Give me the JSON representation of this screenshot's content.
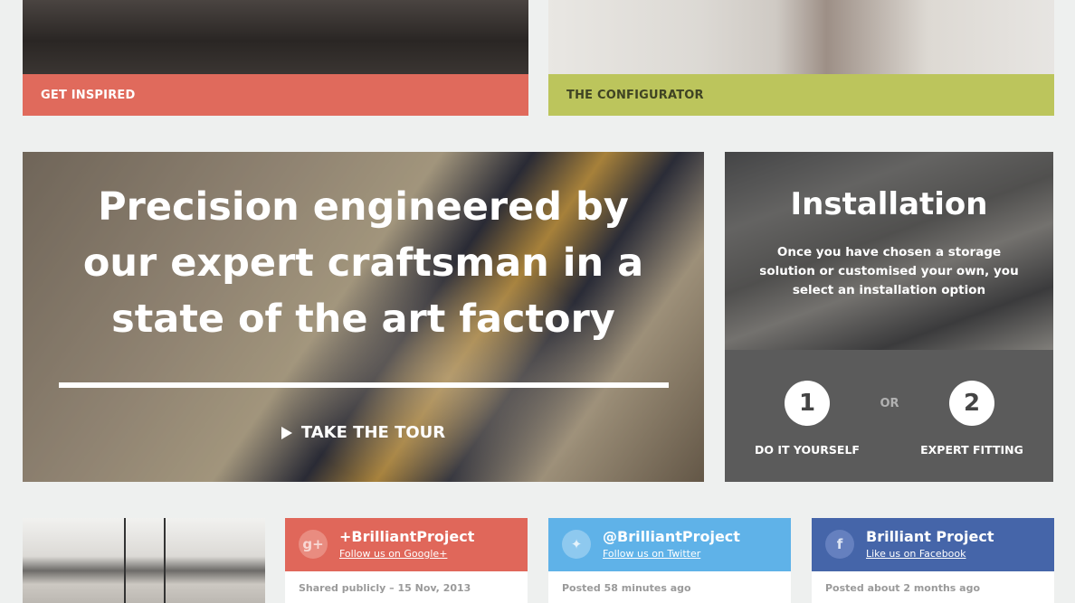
{
  "top_tiles": {
    "inspired_label": "GET INSPIRED",
    "configurator_label": "THE CONFIGURATOR"
  },
  "hero": {
    "headline": "Precision engineered by our expert craftsman in a state of the art factory",
    "cta_label": "TAKE THE TOUR"
  },
  "installation": {
    "title": "Installation",
    "description": "Once you have chosen a storage solution or customised your own, you select an installation option",
    "option_1_number": "1",
    "option_1_label": "DO IT YOURSELF",
    "or_label": "OR",
    "option_2_number": "2",
    "option_2_label": "EXPERT FITTING"
  },
  "social": {
    "google": {
      "icon": "google-plus-icon",
      "icon_glyph": "g+",
      "handle": "+BrilliantProject",
      "follow": "Follow us on Google+",
      "meta": "Shared publicly – 15 Nov, 2013"
    },
    "twitter": {
      "icon": "twitter-icon",
      "icon_glyph": "✦",
      "handle": "@BrilliantProject",
      "follow": "Follow us on Twitter",
      "meta": "Posted 58 minutes ago"
    },
    "facebook": {
      "icon": "facebook-icon",
      "icon_glyph": "f",
      "handle": "Brilliant Project",
      "follow": "Like us on Facebook",
      "meta": "Posted about 2 months ago"
    }
  },
  "colors": {
    "inspired": "#e06a5c",
    "configurator": "#bcc55c",
    "google": "#e0675a",
    "twitter": "#5fb2e8",
    "facebook": "#4565a9"
  }
}
